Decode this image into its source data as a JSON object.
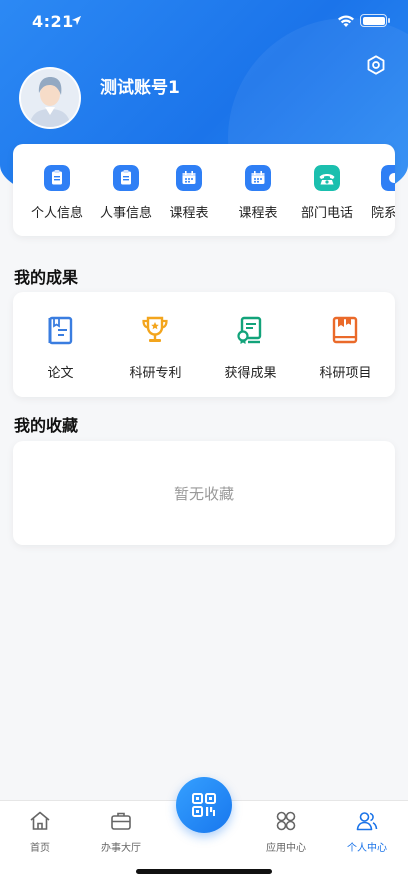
{
  "status_bar": {
    "time": "4:21"
  },
  "profile": {
    "username": "测试账号1"
  },
  "quick_items": [
    {
      "label": "个人信息",
      "icon": "clipboard-icon",
      "color": "#2f7ff5"
    },
    {
      "label": "人事信息",
      "icon": "clipboard-icon",
      "color": "#2f7ff5"
    },
    {
      "label": "课程表",
      "icon": "calendar-icon",
      "color": "#2f7ff5"
    },
    {
      "label": "课程表",
      "icon": "calendar-icon",
      "color": "#2f7ff5"
    },
    {
      "label": "部门电话",
      "icon": "phone-icon",
      "color": "#1bbfae"
    },
    {
      "label": "院系",
      "icon": "app-icon",
      "color": "#2f7ff5"
    }
  ],
  "achievements": {
    "title": "我的成果",
    "items": [
      {
        "label": "论文",
        "icon": "paper-icon",
        "color": "#3a7de0"
      },
      {
        "label": "科研专利",
        "icon": "trophy-icon",
        "color": "#f3a51d"
      },
      {
        "label": "获得成果",
        "icon": "certificate-icon",
        "color": "#12a37a"
      },
      {
        "label": "科研项目",
        "icon": "book-icon",
        "color": "#ea6a2a"
      }
    ]
  },
  "favorites": {
    "title": "我的收藏",
    "empty_text": "暂无收藏"
  },
  "tabbar": {
    "items": [
      {
        "label": "首页",
        "icon": "home-icon",
        "active": false
      },
      {
        "label": "办事大厅",
        "icon": "briefcase-icon",
        "active": false
      },
      {
        "label": "应用中心",
        "icon": "apps-icon",
        "active": false
      },
      {
        "label": "个人中心",
        "icon": "user-icon",
        "active": true
      }
    ]
  },
  "colors": {
    "accent": "#1a73e8",
    "header": "#2c89f4"
  }
}
